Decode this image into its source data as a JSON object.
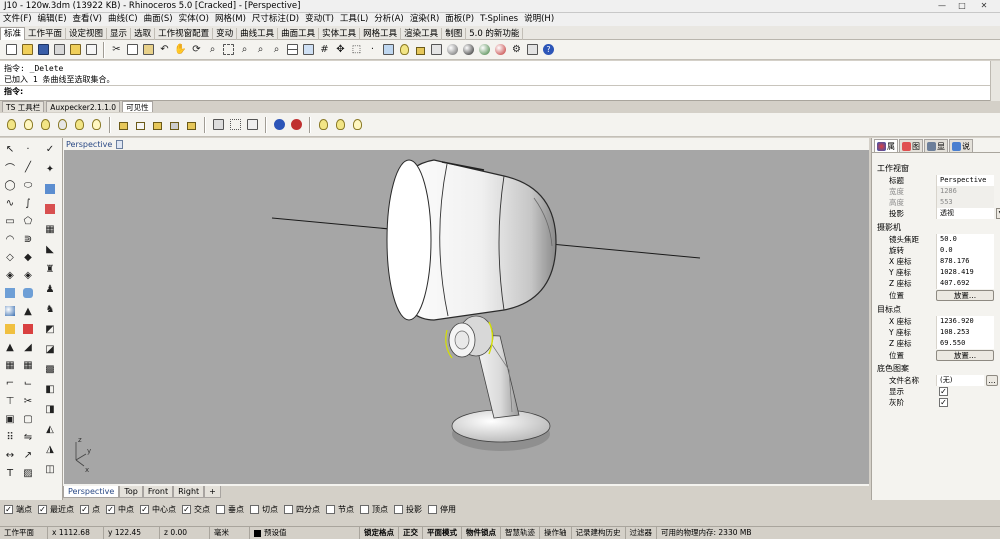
{
  "titlebar": {
    "title": "J10 - 120w.3dm (13922 KB) - Rhinoceros 5.0 [Cracked] - [Perspective]",
    "minimize": "—",
    "maximize": "□",
    "close": "✕"
  },
  "menu": [
    "文件(F)",
    "编辑(E)",
    "查看(V)",
    "曲线(C)",
    "曲面(S)",
    "实体(O)",
    "网格(M)",
    "尺寸标注(D)",
    "变动(T)",
    "工具(L)",
    "分析(A)",
    "渲染(R)",
    "面板(P)",
    "T-Splines",
    "说明(H)"
  ],
  "tool_tabs": [
    "标准",
    "工作平面",
    "设定视图",
    "显示",
    "选取",
    "工作视窗配置",
    "变动",
    "曲线工具",
    "曲面工具",
    "实体工具",
    "网格工具",
    "渲染工具",
    "制图",
    "5.0 的新功能"
  ],
  "command": {
    "line1": "指令: _Delete",
    "line2": "已加入 1 条曲线至选取集合。",
    "prompt": "指令:"
  },
  "toolbar2_tabs": [
    "TS 工具栏",
    "Auxpecker2.1.1.0",
    "可见性"
  ],
  "viewport": {
    "title": "Perspective",
    "axis_x": "x",
    "axis_y": "y",
    "axis_z": "z",
    "tabs": [
      "Perspective",
      "Top",
      "Front",
      "Right"
    ],
    "add_tab": "+"
  },
  "panel": {
    "tabs": [
      "属",
      "图",
      "显",
      "说"
    ],
    "viewport_section": "工作视窗",
    "title_label": "标题",
    "title_value": "Perspective",
    "width_label": "宽度",
    "width_value": "1286",
    "height_label": "高度",
    "height_value": "553",
    "projection_label": "投影",
    "projection_value": "透视",
    "camera_section": "摄影机",
    "lens_label": "镜头焦距",
    "lens_value": "50.0",
    "rotation_label": "旋转",
    "rotation_value": "0.0",
    "cam_x_label": "X 座标",
    "cam_x_value": "878.176",
    "cam_y_label": "Y 座标",
    "cam_y_value": "1028.419",
    "cam_z_label": "Z 座标",
    "cam_z_value": "407.692",
    "cam_pos_label": "位置",
    "cam_pos_button": "放置...",
    "target_section": "目标点",
    "tgt_x_label": "X 座标",
    "tgt_x_value": "1236.920",
    "tgt_y_label": "Y 座标",
    "tgt_y_value": "108.253",
    "tgt_z_label": "Z 座标",
    "tgt_z_value": "69.550",
    "tgt_pos_label": "位置",
    "tgt_pos_button": "放置...",
    "bg_section": "底色图案",
    "filename_label": "文件名称",
    "filename_value": "(无)",
    "browse_button": "...",
    "show_label": "显示",
    "gray_label": "灰阶",
    "check": "✓"
  },
  "osnap": [
    {
      "label": "端点",
      "checked": true
    },
    {
      "label": "最近点",
      "checked": true
    },
    {
      "label": "点",
      "checked": true
    },
    {
      "label": "中点",
      "checked": true
    },
    {
      "label": "中心点",
      "checked": true
    },
    {
      "label": "交点",
      "checked": true
    },
    {
      "label": "垂点",
      "checked": false
    },
    {
      "label": "切点",
      "checked": false
    },
    {
      "label": "四分点",
      "checked": false
    },
    {
      "label": "节点",
      "checked": false
    },
    {
      "label": "顶点",
      "checked": false
    },
    {
      "label": "投影",
      "checked": false
    },
    {
      "label": "停用",
      "checked": false
    }
  ],
  "status": {
    "cplane": "工作平面",
    "x": "x 1112.68",
    "y": "y 122.45",
    "z": "z 0.00",
    "unit": "毫米",
    "layer": "预设值",
    "grid_snap": "锁定格点",
    "ortho": "正交",
    "planar": "平面模式",
    "osnap": "物件锁点",
    "smart_track": "智慧轨迹",
    "gumball": "操作轴",
    "history": "记录建构历史",
    "filter": "过滤器",
    "memory": "可用的物理内存: 2330 MB"
  },
  "colors": {
    "viewport_bg": "#a6a6a6",
    "viewport_title": "#2b4a86",
    "highlight_ring": "#d4e000"
  }
}
